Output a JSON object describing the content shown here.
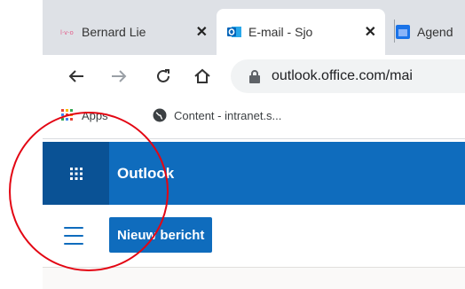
{
  "browser": {
    "tabs": [
      {
        "title": "Bernard Lie",
        "favicon": "lvo-logo-icon",
        "active": false
      },
      {
        "title": "E-mail - Sjo",
        "favicon": "outlook-logo-icon",
        "active": true
      },
      {
        "title": "Agend",
        "favicon": "calendar-app-icon",
        "active": false
      }
    ],
    "close_glyph": "✕",
    "url": "outlook.office.com/mai",
    "nav_icons": [
      "back-arrow-icon",
      "forward-arrow-icon",
      "reload-icon",
      "home-icon"
    ],
    "bookmarks": [
      {
        "label": "Apps",
        "icon": "apps-grid-icon"
      },
      {
        "label": "Content - intranet.s...",
        "icon": "globe-icon"
      }
    ]
  },
  "outlook": {
    "brand": "Outlook",
    "new_message_label": "Nieuw bericht",
    "header_color": "#0f6cbd",
    "waffle_color": "#0a5295"
  },
  "annotation": {
    "shape": "circle",
    "color": "#e30613"
  }
}
